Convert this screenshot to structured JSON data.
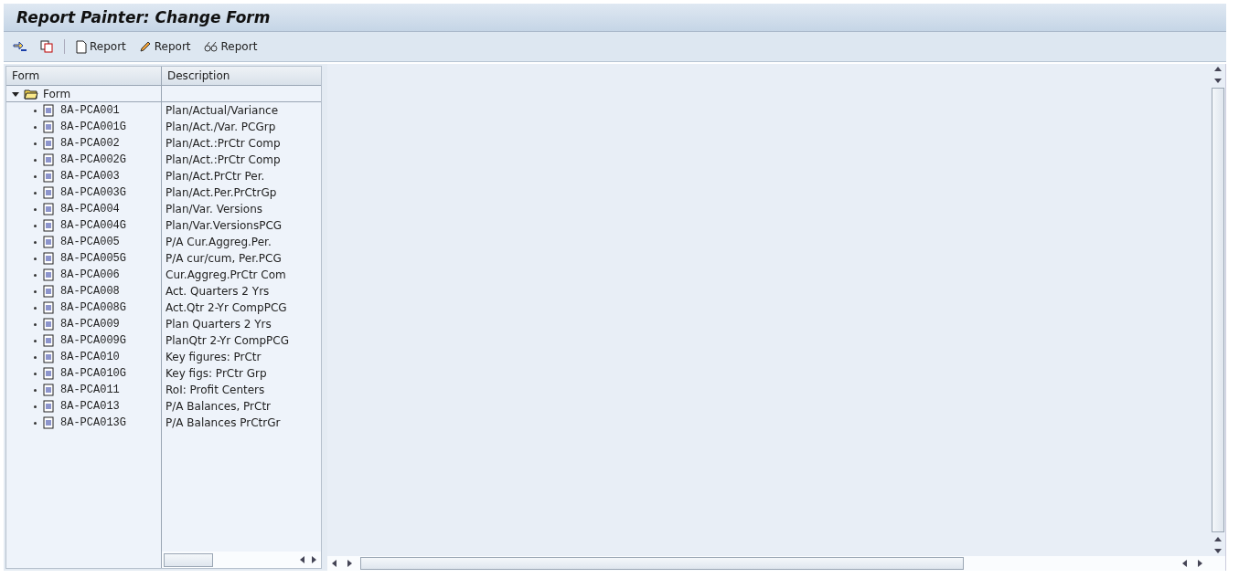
{
  "window": {
    "title": "Report Painter: Change Form"
  },
  "toolbar": [
    {
      "kind": "navigate"
    },
    {
      "kind": "copy"
    },
    {
      "kind": "create",
      "label": "Report"
    },
    {
      "kind": "change",
      "label": "Report"
    },
    {
      "kind": "display",
      "label": "Report"
    }
  ],
  "tree": {
    "columns": [
      "Form",
      "Description"
    ],
    "root": {
      "label": "Form",
      "expanded": true,
      "children": [
        {
          "name": "8A-PCA001",
          "description": "Plan/Actual/Variance"
        },
        {
          "name": "8A-PCA001G",
          "description": "Plan/Act./Var. PCGrp"
        },
        {
          "name": "8A-PCA002",
          "description": "Plan/Act.:PrCtr Comp"
        },
        {
          "name": "8A-PCA002G",
          "description": "Plan/Act.:PrCtr Comp"
        },
        {
          "name": "8A-PCA003",
          "description": "Plan/Act.PrCtr Per."
        },
        {
          "name": "8A-PCA003G",
          "description": "Plan/Act.Per.PrCtrGp"
        },
        {
          "name": "8A-PCA004",
          "description": "Plan/Var. Versions"
        },
        {
          "name": "8A-PCA004G",
          "description": "Plan/Var.VersionsPCG"
        },
        {
          "name": "8A-PCA005",
          "description": "P/A Cur.Aggreg.Per."
        },
        {
          "name": "8A-PCA005G",
          "description": "P/A cur/cum, Per.PCG"
        },
        {
          "name": "8A-PCA006",
          "description": "Cur.Aggreg.PrCtr Com"
        },
        {
          "name": "8A-PCA008",
          "description": "Act. Quarters 2 Yrs"
        },
        {
          "name": "8A-PCA008G",
          "description": "Act.Qtr 2-Yr CompPCG"
        },
        {
          "name": "8A-PCA009",
          "description": "Plan Quarters 2 Yrs"
        },
        {
          "name": "8A-PCA009G",
          "description": "PlanQtr 2-Yr CompPCG"
        },
        {
          "name": "8A-PCA010",
          "description": "Key figures: PrCtr"
        },
        {
          "name": "8A-PCA010G",
          "description": "Key figs: PrCtr Grp"
        },
        {
          "name": "8A-PCA011",
          "description": "RoI: Profit Centers"
        },
        {
          "name": "8A-PCA013",
          "description": "P/A Balances, PrCtr"
        },
        {
          "name": "8A-PCA013G",
          "description": "P/A Balances PrCtrGr"
        }
      ]
    }
  }
}
